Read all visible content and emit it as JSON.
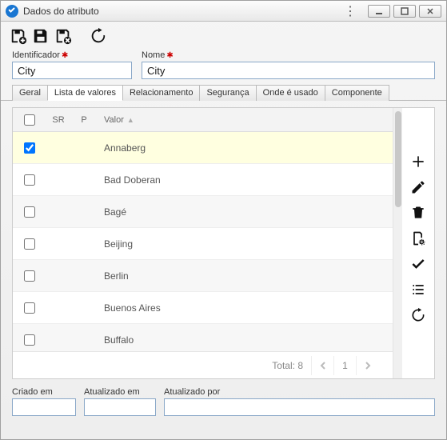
{
  "window": {
    "title": "Dados do atributo"
  },
  "form": {
    "identificador_label": "Identificador",
    "identificador_value": "City",
    "nome_label": "Nome",
    "nome_value": "City"
  },
  "tabs": {
    "geral": "Geral",
    "lista": "Lista de valores",
    "relacionamento": "Relacionamento",
    "seguranca": "Segurança",
    "onde": "Onde é usado",
    "componente": "Componente"
  },
  "grid": {
    "header": {
      "sr": "SR",
      "p": "P",
      "valor": "Valor"
    },
    "rows": [
      {
        "checked": true,
        "sr": "",
        "p": "",
        "valor": "Annaberg"
      },
      {
        "checked": false,
        "sr": "",
        "p": "",
        "valor": "Bad Doberan"
      },
      {
        "checked": false,
        "sr": "",
        "p": "",
        "valor": "Bagé"
      },
      {
        "checked": false,
        "sr": "",
        "p": "",
        "valor": "Beijing"
      },
      {
        "checked": false,
        "sr": "",
        "p": "",
        "valor": "Berlin"
      },
      {
        "checked": false,
        "sr": "",
        "p": "",
        "valor": "Buenos Aires"
      },
      {
        "checked": false,
        "sr": "",
        "p": "",
        "valor": "Buffalo"
      }
    ],
    "footer": {
      "total_label": "Total: 8",
      "page": "1"
    }
  },
  "footer": {
    "criado_label": "Criado em",
    "criado_value": "",
    "atualizado_em_label": "Atualizado em",
    "atualizado_em_value": "",
    "atualizado_por_label": "Atualizado por",
    "atualizado_por_value": ""
  },
  "icons": {
    "save_add": "save-add-icon",
    "save": "save-icon",
    "save_delete": "save-delete-icon",
    "refresh": "refresh-icon",
    "plus": "plus-icon",
    "pencil": "pencil-icon",
    "trash": "trash-icon",
    "page_gear": "page-settings-icon",
    "check": "check-icon",
    "list": "list-icon"
  }
}
